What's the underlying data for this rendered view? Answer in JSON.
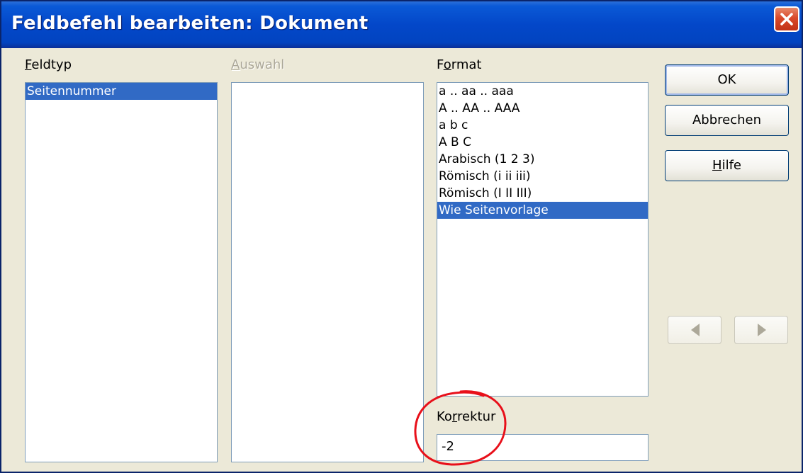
{
  "window": {
    "title": "Feldbefehl bearbeiten: Dokument"
  },
  "feldtyp": {
    "label_acc": "F",
    "label_rest": "eldtyp",
    "items": [
      "Seitennummer"
    ],
    "selected_index": 0
  },
  "auswahl": {
    "label_acc": "A",
    "label_rest": "uswahl",
    "items": []
  },
  "format": {
    "label_pre": "F",
    "label_acc": "o",
    "label_rest": "rmat",
    "items": [
      "a .. aa .. aaa",
      "A .. AA .. AAA",
      "a b c",
      "A B C",
      "Arabisch (1 2 3)",
      "Römisch (i ii iii)",
      "Römisch (I II III)",
      "Wie Seitenvorlage"
    ],
    "selected_index": 7
  },
  "korrektur": {
    "label_pre": "Ko",
    "label_acc": "r",
    "label_rest": "rektur",
    "value": "-2"
  },
  "buttons": {
    "ok": "OK",
    "cancel": "Abbrechen",
    "help_acc": "H",
    "help_rest": "ilfe"
  },
  "colors": {
    "selection": "#316ac5",
    "annotation": "#e8101a"
  }
}
